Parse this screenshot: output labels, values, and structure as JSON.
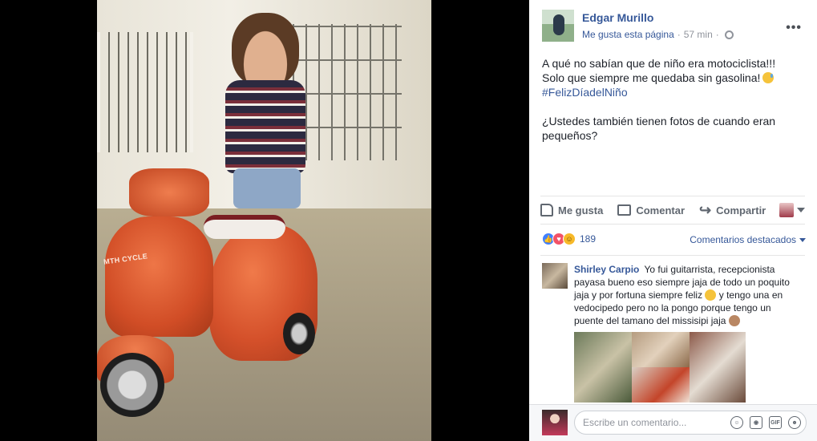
{
  "photo": {
    "scooter_label": "MTH CYCLE"
  },
  "post": {
    "author": "Edgar Murillo",
    "like_page": "Me gusta esta página",
    "separator": "·",
    "time": "57 min",
    "separator2": "·",
    "more": "•••",
    "text_line1": "A qué no sabían que de niño era motociclista!!!",
    "text_line2": "Solo que siempre me quedaba sin gasolina!",
    "hashtag": "#FelizDíadelNiño",
    "question": "¿Ustedes también tienen fotos de cuando eran pequeños?"
  },
  "actions": {
    "like": "Me gusta",
    "comment": "Comentar",
    "share": "Compartir"
  },
  "reactions": {
    "count": "189",
    "sort_label": "Comentarios destacados"
  },
  "comment": {
    "author": "Shirley Carpio",
    "text_part1": "Yo fui guitarrista, recepcionista payasa bueno eso siempre jaja de todo un poquito jaja y por fortuna siempre feliz",
    "text_part2": "y tengo una en vedocipedo pero no la pongo porque tengo un puente del tamano del missisipi jaja"
  },
  "compose": {
    "placeholder": "Escribe un comentario...",
    "gif": "GIF"
  },
  "colors": {
    "link": "#365899",
    "like_blue": "#4080ff",
    "love_red": "#f25268",
    "haha_yellow": "#f7b928"
  }
}
